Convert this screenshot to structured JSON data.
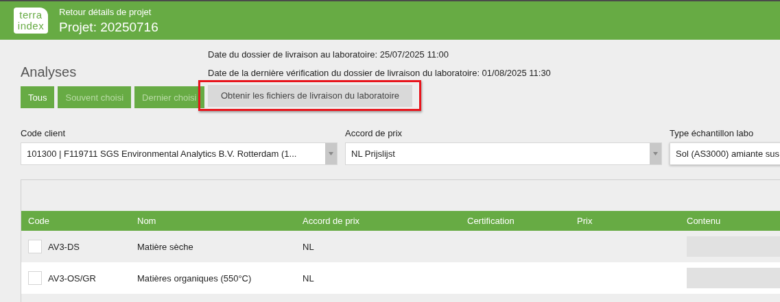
{
  "header": {
    "logo_lines": [
      "terra",
      "index"
    ],
    "subtitle": "Retour détails de projet",
    "title": "Projet: 20250716"
  },
  "analyses": {
    "title": "Analyses",
    "filters": [
      {
        "label": "Tous",
        "selected": true
      },
      {
        "label": "Souvent choisi",
        "selected": false
      },
      {
        "label": "Dernier choisi",
        "selected": false
      }
    ]
  },
  "delivery": {
    "lines": [
      "Date du dossier de livraison au laboratoire: 25/07/2025 11:00",
      "Date de la dernière vérification du dossier de livraison du laboratoire: 01/08/2025 11:30"
    ],
    "button": {
      "label": "Obtenir les fichiers de livraison du laboratoire",
      "highlighted": true
    }
  },
  "selects": [
    {
      "label": "Code client",
      "value": "101300 | F119711 SGS Environmental Analytics B.V. Rotterdam (1...",
      "dropdown": true
    },
    {
      "label": "Accord de prix",
      "value": "NL Prijslijst",
      "dropdown": true
    },
    {
      "label": "Type échantillon labo",
      "value": "Sol (AS3000) amiante sus"
    }
  ],
  "table": {
    "columns": [
      "Code",
      "Nom",
      "Accord de prix",
      "Certification",
      "Prix",
      "Contenu"
    ],
    "rows": [
      {
        "checked": false,
        "code": "AV3-DS",
        "name": "Matière sèche",
        "price_agreement": "NL"
      },
      {
        "checked": false,
        "code": "AV3-OS/GR",
        "name": "Matières organiques (550°C)",
        "price_agreement": "NL"
      }
    ]
  }
}
